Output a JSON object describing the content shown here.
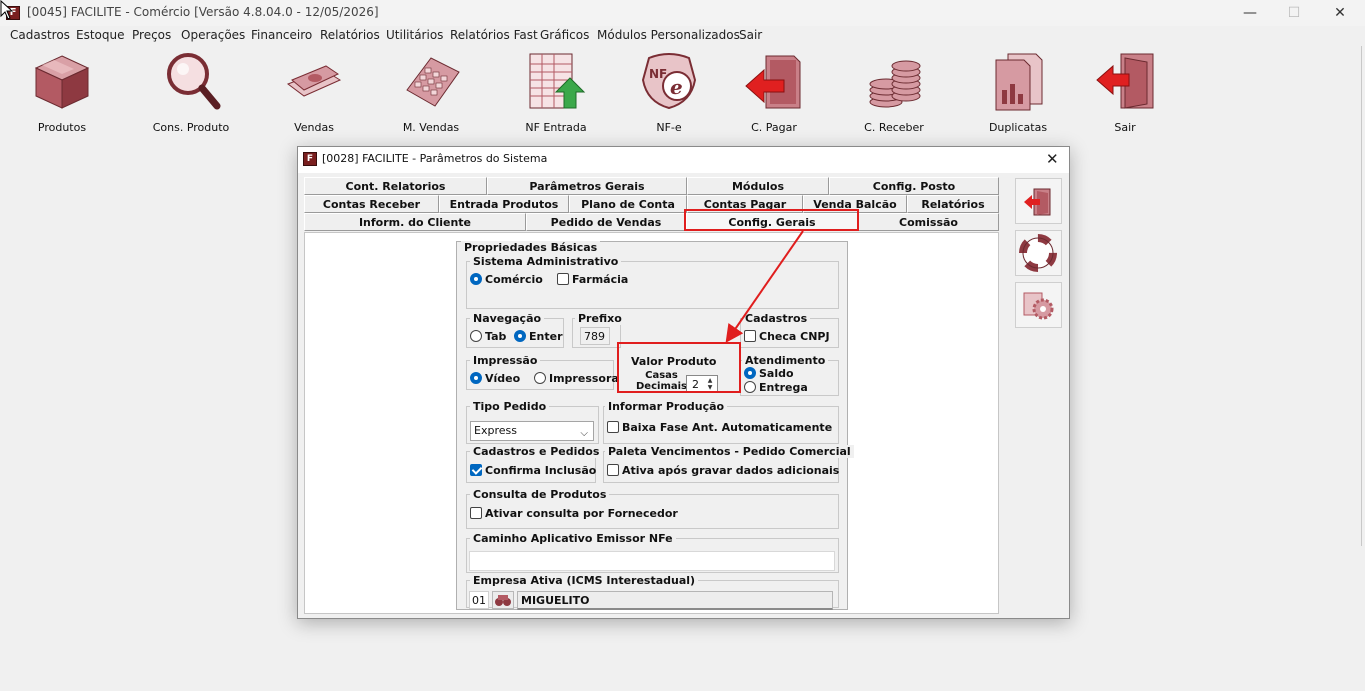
{
  "window": {
    "title": "[0045] FACILITE - Comércio [Versão 4.8.04.0 - 12/05/2026]",
    "icon": "facilite-app-icon",
    "controls": [
      "minimize",
      "maximize",
      "close"
    ],
    "minimize_glyph": "—",
    "maximize_glyph": "☐",
    "close_glyph": "✕"
  },
  "menubar": {
    "items": [
      "Cadastros",
      "Estoque",
      "Preços",
      "Operações",
      "Financeiro",
      "Relatórios",
      "Utilitários",
      "Relatórios Fast",
      "Gráficos",
      "Módulos Personalizados",
      "Sair"
    ]
  },
  "toolbar": {
    "items": [
      {
        "label": "Produtos",
        "icon": "box-icon"
      },
      {
        "label": "Cons. Produto",
        "icon": "magnifier-icon"
      },
      {
        "label": "Vendas",
        "icon": "money-icon"
      },
      {
        "label": "M. Vendas",
        "icon": "keypad-icon"
      },
      {
        "label": "NF Entrada",
        "icon": "spreadsheet-arrow-up-icon"
      },
      {
        "label": "NF-e",
        "icon": "nfe-icon"
      },
      {
        "label": "C. Pagar",
        "icon": "document-arrow-left-icon"
      },
      {
        "label": "C. Receber",
        "icon": "coins-icon"
      },
      {
        "label": "Duplicatas",
        "icon": "duplicate-docs-icon"
      },
      {
        "label": "Sair",
        "icon": "exit-door-icon"
      }
    ]
  },
  "dialog": {
    "title": "[0028] FACILITE - Parâmetros do Sistema",
    "close_glyph": "✕",
    "tabs_row1": [
      "Cont. Relatorios",
      "Parâmetros Gerais",
      "Módulos",
      "Config. Posto"
    ],
    "tabs_row2": [
      "Contas Receber",
      "Entrada Produtos",
      "Plano de Conta",
      "Contas Pagar",
      "Venda Balcão",
      "Relatórios"
    ],
    "tabs_row3": [
      "Inform. do Cliente",
      "Pedido de Vendas",
      "Config. Gerais",
      "Comissão"
    ],
    "active_tab": "Config. Gerais",
    "side_buttons": [
      "exit-door-icon",
      "lifebuoy-icon",
      "gear-icon"
    ]
  },
  "props": {
    "title": "Propriedades Básicas",
    "sistema_admin": {
      "label": "Sistema Administrativo",
      "opt1": "Comércio",
      "opt2": "Farmácia",
      "selected": "Comércio"
    },
    "navegacao": {
      "label": "Navegação",
      "opt1": "Tab",
      "opt2": "Enter",
      "selected": "Enter"
    },
    "prefixo": {
      "label": "Prefixo",
      "value": "789"
    },
    "cadastros": {
      "label": "Cadastros",
      "check": "Checa CNPJ",
      "checked": false
    },
    "impressao": {
      "label": "Impressão",
      "opt1": "Vídeo",
      "opt2": "Impressora",
      "selected": "Vídeo"
    },
    "valor_produto": {
      "label": "Valor Produto",
      "casas1": "Casas",
      "casas2": "Decimais",
      "value": "2",
      "spin_up": "▲",
      "spin_down": "▼"
    },
    "atendimento": {
      "label": "Atendimento",
      "opt1": "Saldo",
      "opt2": "Entrega",
      "selected": "Saldo"
    },
    "tipo_pedido": {
      "label": "Tipo Pedido",
      "value": "Express",
      "arrow": "⌵"
    },
    "informar_producao": {
      "label": "Informar Produção",
      "check": "Baixa Fase Ant. Automaticamente",
      "checked": false
    },
    "cadastros_pedidos": {
      "label": "Cadastros e Pedidos",
      "check": "Confirma Inclusão",
      "checked": true
    },
    "paleta": {
      "label": "Paleta Vencimentos - Pedido Comercial",
      "check": "Ativa após gravar dados adicionais",
      "checked": false
    },
    "consulta_produtos": {
      "label": "Consulta de Produtos",
      "check": "Ativar consulta por Fornecedor",
      "checked": false
    },
    "caminho_nfe": {
      "label": "Caminho Aplicativo Emissor NFe",
      "value": ""
    },
    "empresa_ativa": {
      "label": "Empresa Ativa (ICMS Interestadual)",
      "code": "01",
      "name": "MIGUELITO"
    }
  },
  "colors": {
    "accent": "#0067c0",
    "highlight": "#e01e1e",
    "icon_maroon": "#b5545c"
  }
}
